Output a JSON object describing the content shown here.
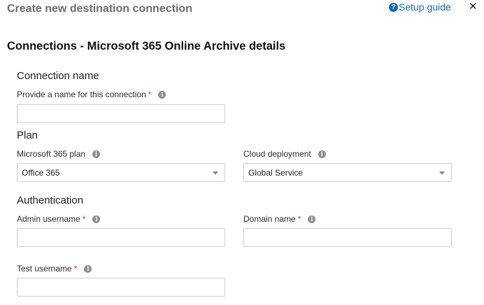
{
  "header": {
    "title": "Create new destination connection",
    "setup_guide": "Setup guide",
    "close": "✕"
  },
  "page_title": "Connections - Microsoft 365 Online Archive details",
  "sections": {
    "connection_name": {
      "title": "Connection name",
      "name_label": "Provide a name for this connection",
      "name_value": ""
    },
    "plan": {
      "title": "Plan",
      "m365_plan_label": "Microsoft 365 plan",
      "m365_plan_value": "Office 365",
      "cloud_label": "Cloud deployment",
      "cloud_value": "Global Service"
    },
    "authentication": {
      "title": "Authentication",
      "admin_label": "Admin username",
      "admin_value": "",
      "domain_label": "Domain name",
      "domain_value": "",
      "test_label": "Test username",
      "test_value": ""
    }
  },
  "symbols": {
    "required": "*",
    "info": "i",
    "help": "?"
  },
  "colors": {
    "link": "#1665c0",
    "required": "#d32f2f",
    "border": "#cfcfcf"
  }
}
